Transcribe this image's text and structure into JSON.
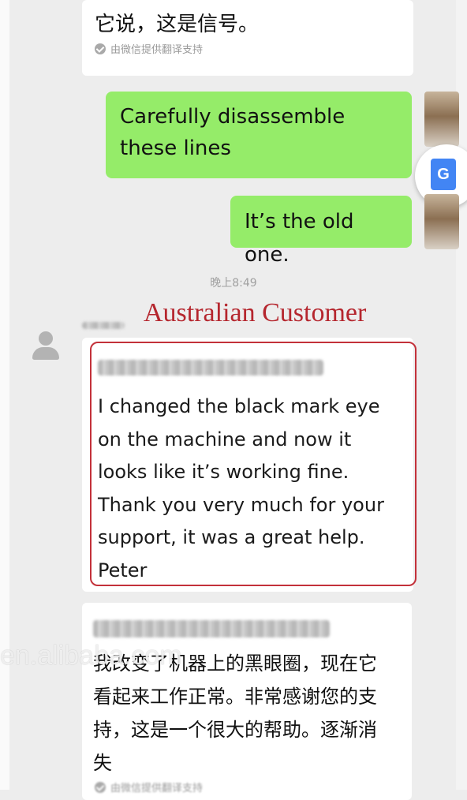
{
  "chat": {
    "message_1": {
      "text": "它说，这是信号。",
      "translation_note": "由微信提供翻译支持"
    },
    "message_2": {
      "text": "Carefully disassemble these lines"
    },
    "message_3": {
      "text": "It’s the old one."
    },
    "timestamp": "晚上8:49",
    "overlay_label": "Australian Customer",
    "message_4": {
      "lines": [
        "I changed the black mark eye",
        "on the machine and now it",
        "looks like it’s working fine.",
        "Thank you very much for your",
        "support, it was a great help.",
        "Peter"
      ]
    },
    "message_5": {
      "lines": [
        "我改变了机器上的黑眼圈，现在它",
        "看起来工作正常。非常感谢您的支",
        "持，这是一个很大的帮助。逐渐消",
        "失"
      ],
      "translation_note": "由微信提供翻译支持"
    }
  },
  "translate_button": {
    "icon": "google-translate-icon",
    "glyph": "G",
    "color": "#4285f4"
  },
  "watermark": "en.alibaba.com",
  "colors": {
    "sent_bubble": "#95ec69",
    "highlight": "#c3313a",
    "background": "#ededed"
  }
}
